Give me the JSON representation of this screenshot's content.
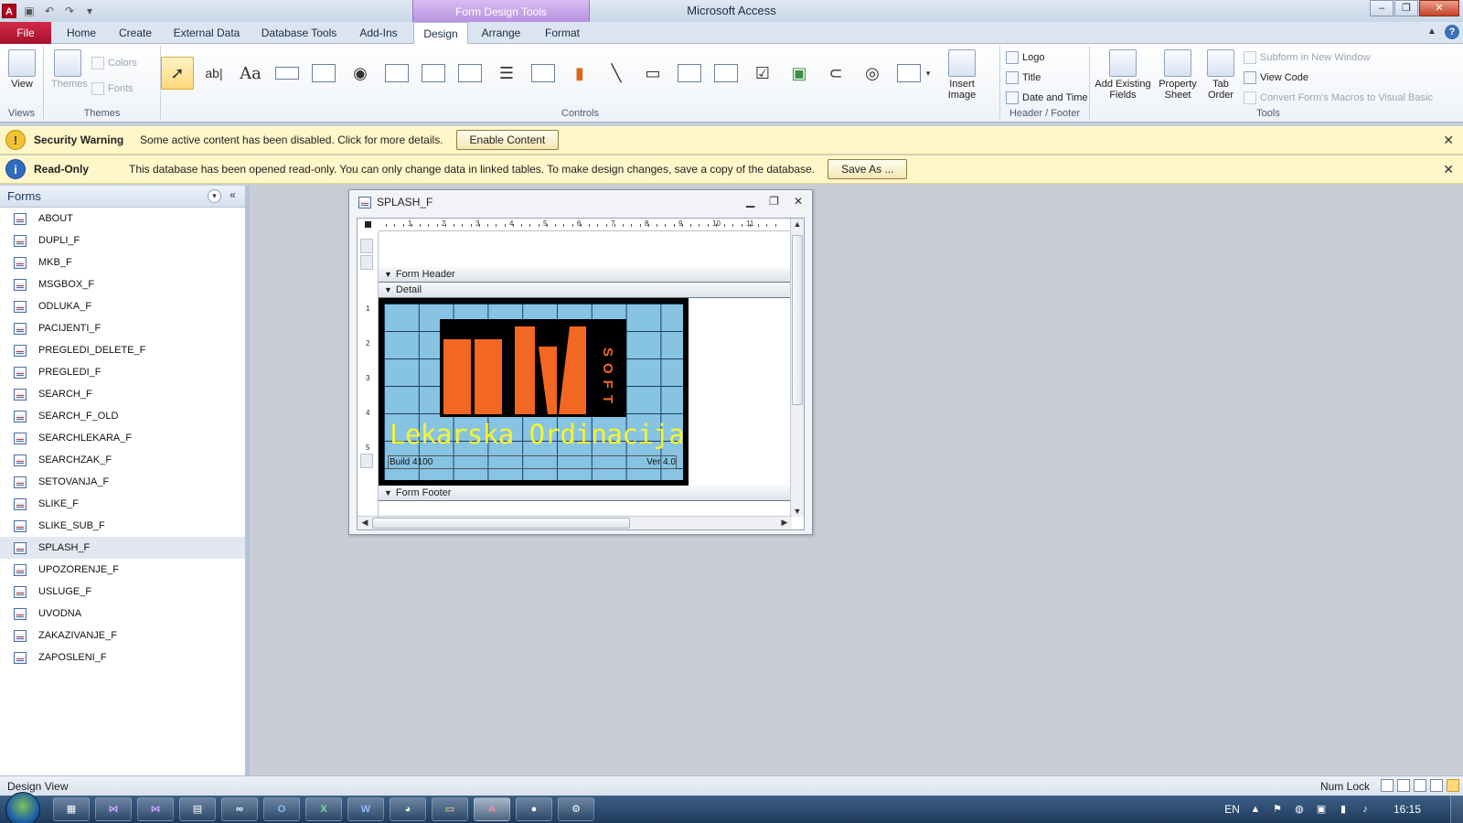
{
  "title_bar": {
    "context_tool": "Form Design Tools",
    "app_title": "Microsoft Access"
  },
  "ribbon_tabs": {
    "file": "File",
    "home": "Home",
    "create": "Create",
    "external_data": "External Data",
    "database_tools": "Database Tools",
    "add_ins": "Add-Ins",
    "design": "Design",
    "arrange": "Arrange",
    "format": "Format"
  },
  "ribbon": {
    "views": {
      "view_label": "View",
      "group": "Views"
    },
    "themes": {
      "themes_label": "Themes",
      "colors_label": "Colors",
      "fonts_label": "Fonts",
      "group": "Themes"
    },
    "controls": {
      "group": "Controls",
      "insert_image": "Insert Image"
    },
    "header_footer": {
      "logo": "Logo",
      "title": "Title",
      "date_time": "Date and Time",
      "group": "Header / Footer"
    },
    "tools": {
      "add_existing_fields": "Add Existing Fields",
      "property_sheet": "Property Sheet",
      "tab_order": "Tab Order",
      "subform_new_window": "Subform in New Window",
      "view_code": "View Code",
      "convert_macros": "Convert Form's Macros to Visual Basic",
      "group": "Tools"
    }
  },
  "security_bar": {
    "title": "Security Warning",
    "message": "Some active content has been disabled. Click for more details.",
    "button": "Enable Content"
  },
  "readonly_bar": {
    "title": "Read-Only",
    "message": "This database has been opened read-only. You can only change data in linked tables. To make design changes, save a copy of the database.",
    "button": "Save As ..."
  },
  "nav_pane": {
    "header": "Forms",
    "items": [
      "ABOUT",
      "DUPLI_F",
      "MKB_F",
      "MSGBOX_F",
      "ODLUKA_F",
      "PACIJENTI_F",
      "PREGLEDI_DELETE_F",
      "PREGLEDI_F",
      "SEARCH_F",
      "SEARCH_F_OLD",
      "SEARCHLEKARA_F",
      "SEARCHZAK_F",
      "SETOVANJA_F",
      "SLIKE_F",
      "SLIKE_SUB_F",
      "SPLASH_F",
      "UPOZORENJE_F",
      "USLUGE_F",
      "UVODNA",
      "ZAKAZIVANJE_F",
      "ZAPOSLENI_F"
    ],
    "selected": "SPLASH_F"
  },
  "form_window": {
    "title": "SPLASH_F",
    "sections": {
      "header": "Form Header",
      "detail": "Detail",
      "footer": "Form Footer"
    },
    "ruler_top": [
      "1",
      "2",
      "3",
      "4",
      "5",
      "6",
      "7",
      "8",
      "9",
      "10",
      "11"
    ],
    "ruler_left": [
      "1",
      "2",
      "3",
      "4",
      "5"
    ],
    "splash": {
      "soft_text": "SOFT",
      "app_name": "Lekarska Ordinacija",
      "build": "Build 4100",
      "version": "Ver 4.0"
    }
  },
  "status_bar": {
    "mode": "Design View",
    "num_lock": "Num Lock"
  },
  "taskbar": {
    "language": "EN",
    "clock": "16:15"
  },
  "colors": {
    "file_tab": "#b0132f",
    "context_tab": "#b892e0",
    "message_bar": "#fff6c9",
    "splash_background": "#87c3e3",
    "logo_orange": "#f26722",
    "splash_title": "#f8f52a"
  }
}
